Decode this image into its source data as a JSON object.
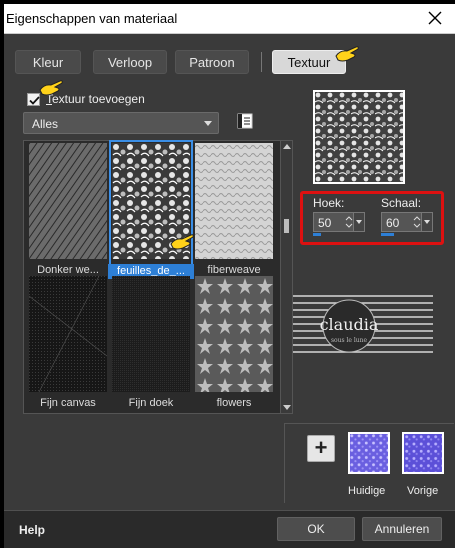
{
  "window": {
    "title": "Eigenschappen van materiaal"
  },
  "tabs": [
    {
      "label": "Kleur",
      "active": false
    },
    {
      "label": "Verloop",
      "active": false
    },
    {
      "label": "Patroon",
      "active": false
    },
    {
      "label": "Textuur",
      "active": true
    }
  ],
  "texture": {
    "add_checkbox_label_u": "T",
    "add_checkbox_label_rest": "extuur toevoegen",
    "add_checked": true,
    "category_value": "Alles"
  },
  "gallery": {
    "items": [
      {
        "caption": "Donker we...",
        "selected": false
      },
      {
        "caption": "feuilles_de_...",
        "selected": true
      },
      {
        "caption": "fiberweave",
        "selected": false
      },
      {
        "caption": "Fijn canvas",
        "selected": false
      },
      {
        "caption": "Fijn doek",
        "selected": false
      },
      {
        "caption": "flowers",
        "selected": false
      }
    ]
  },
  "controls": {
    "angle_label": "Hoek:",
    "angle_value": "50",
    "scale_label": "Schaal:",
    "scale_value": "60"
  },
  "watermark": {
    "name": "claudia",
    "tagline": "sous le lune"
  },
  "materials": {
    "add_icon": "plus-icon",
    "current_label": "Huidige",
    "previous_label": "Vorige",
    "swatch_color": "#6a5fe0"
  },
  "footer": {
    "help_label": "Help",
    "ok_label": "OK",
    "cancel_label": "Annuleren"
  },
  "colors": {
    "accent": "#2d7fd6",
    "highlight_box": "#d11111",
    "dialog_bg": "#3a3a3a"
  }
}
